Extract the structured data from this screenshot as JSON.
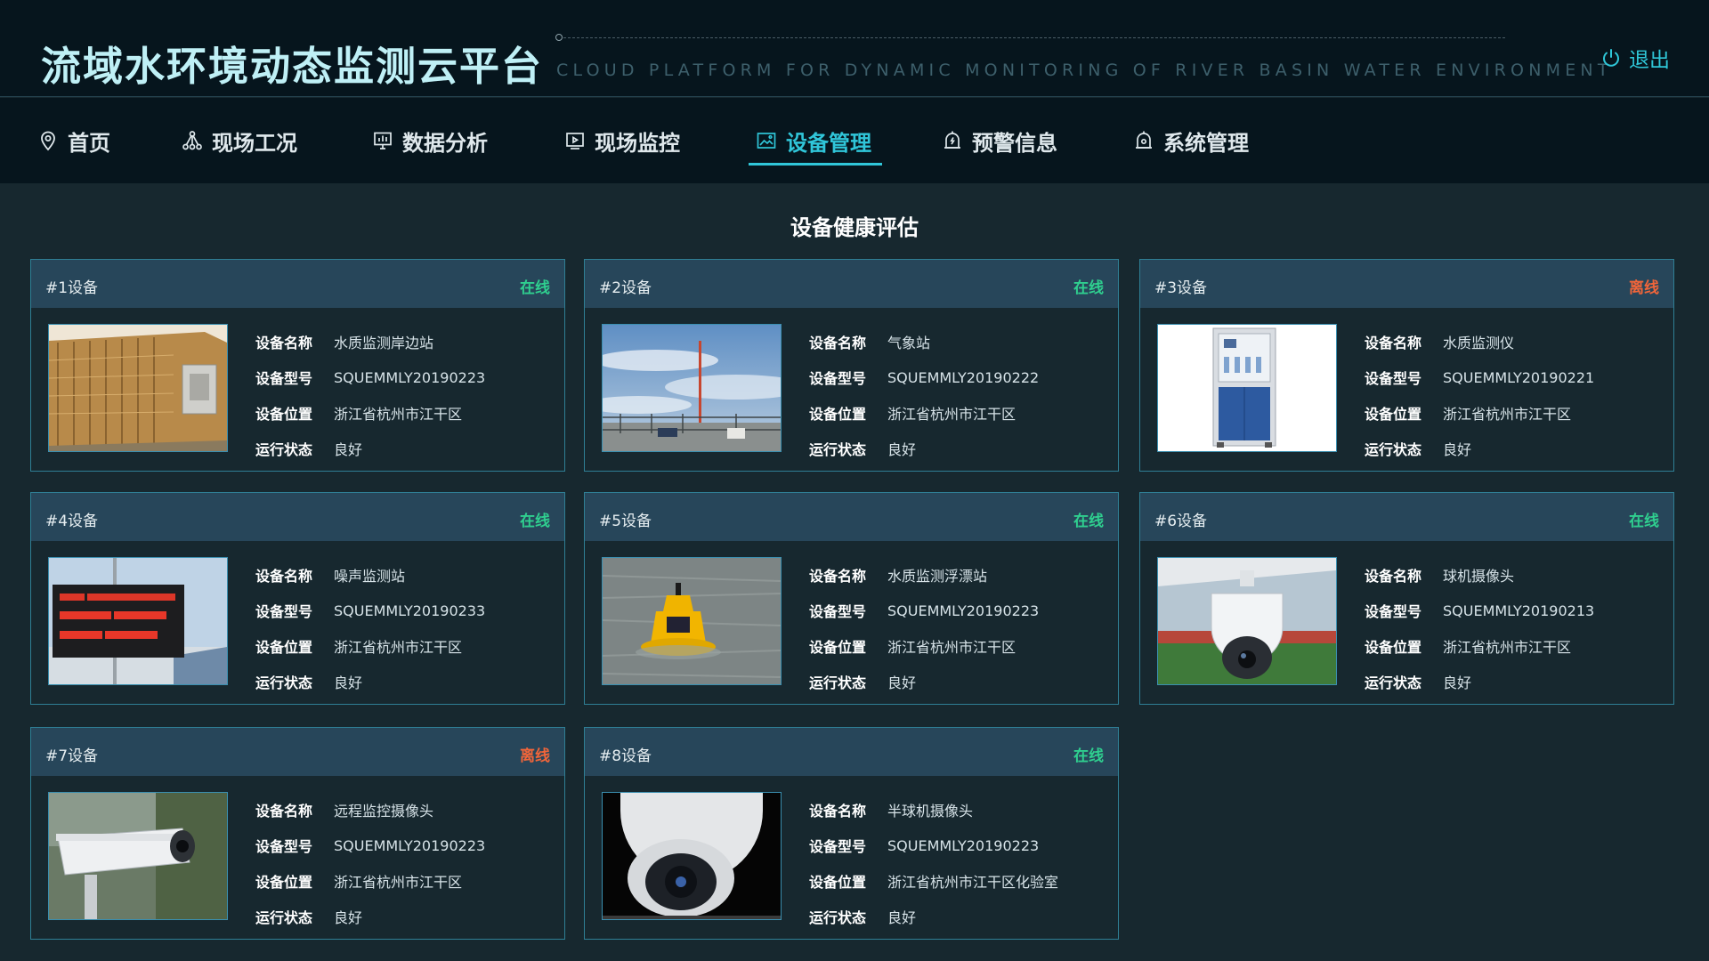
{
  "header": {
    "title": "流域水环境动态监测云平台",
    "subtitle": "CLOUD PLATFORM FOR DYNAMIC MONITORING OF RIVER BASIN WATER ENVIRONMENT",
    "logout_label": "退出",
    "accent": "#30c6d9"
  },
  "nav": {
    "items": [
      {
        "label": "首页",
        "icon": "location-pin-icon"
      },
      {
        "label": "现场工况",
        "icon": "network-icon"
      },
      {
        "label": "数据分析",
        "icon": "chart-monitor-icon"
      },
      {
        "label": "现场监控",
        "icon": "video-play-icon"
      },
      {
        "label": "设备管理",
        "icon": "image-chart-icon",
        "active": true
      },
      {
        "label": "预警信息",
        "icon": "alert-bell-icon"
      },
      {
        "label": "系统管理",
        "icon": "settings-bell-icon"
      }
    ]
  },
  "main": {
    "section_title": "设备健康评估",
    "field_labels": {
      "name": "设备名称",
      "model": "设备型号",
      "location": "设备位置",
      "state": "运行状态"
    },
    "devices": [
      {
        "no": "#1设备",
        "status": "在线",
        "online": true,
        "name": "水质监测岸边站",
        "model": "SQUEMMLY20190223",
        "location": "浙江省杭州市江干区",
        "state": "良好",
        "image": "shore-station-photo"
      },
      {
        "no": "#2设备",
        "status": "在线",
        "online": true,
        "name": "气象站",
        "model": "SQUEMMLY20190222",
        "location": "浙江省杭州市江干区",
        "state": "良好",
        "image": "weather-station-photo"
      },
      {
        "no": "#3设备",
        "status": "离线",
        "online": false,
        "name": "水质监测仪",
        "model": "SQUEMMLY20190221",
        "location": "浙江省杭州市江干区",
        "state": "良好",
        "image": "water-analyzer-photo"
      },
      {
        "no": "#4设备",
        "status": "在线",
        "online": true,
        "name": "噪声监测站",
        "model": "SQUEMMLY20190233",
        "location": "浙江省杭州市江干区",
        "state": "良好",
        "image": "noise-display-photo"
      },
      {
        "no": "#5设备",
        "status": "在线",
        "online": true,
        "name": "水质监测浮漂站",
        "model": "SQUEMMLY20190223",
        "location": "浙江省杭州市江干区",
        "state": "良好",
        "image": "buoy-photo"
      },
      {
        "no": "#6设备",
        "status": "在线",
        "online": true,
        "name": "球机摄像头",
        "model": "SQUEMMLY20190213",
        "location": "浙江省杭州市江干区",
        "state": "良好",
        "image": "dome-camera-photo"
      },
      {
        "no": "#7设备",
        "status": "离线",
        "online": false,
        "name": "远程监控摄像头",
        "model": "SQUEMMLY20190223",
        "location": "浙江省杭州市江干区",
        "state": "良好",
        "image": "bullet-camera-photo"
      },
      {
        "no": "#8设备",
        "status": "在线",
        "online": true,
        "name": "半球机摄像头",
        "model": "SQUEMMLY20190223",
        "location": "浙江省杭州市江干区化验室",
        "state": "良好",
        "image": "turret-camera-photo"
      }
    ]
  }
}
